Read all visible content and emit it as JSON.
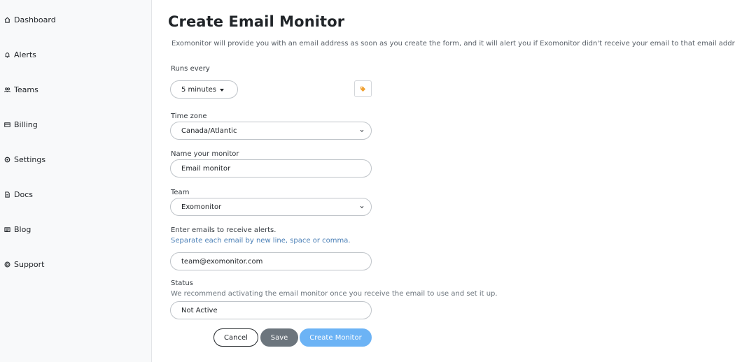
{
  "sidebar": {
    "items": [
      {
        "label": "Dashboard",
        "icon": "home-icon"
      },
      {
        "label": "Alerts",
        "icon": "bell-icon"
      },
      {
        "label": "Teams",
        "icon": "users-icon"
      },
      {
        "label": "Billing",
        "icon": "card-icon"
      },
      {
        "label": "Settings",
        "icon": "gear-icon"
      },
      {
        "label": "Docs",
        "icon": "doc-icon"
      },
      {
        "label": "Blog",
        "icon": "newspaper-icon"
      },
      {
        "label": "Support",
        "icon": "lifebuoy-icon"
      }
    ]
  },
  "form": {
    "title": "Create Email Monitor",
    "description": "Exomonitor will provide you with an email address as soon as you create the form, and it will alert you if Exomonitor didn't receive your email to that email address.",
    "runs_every": {
      "label": "Runs every",
      "value": "5 minutes"
    },
    "tag_icon": "tag-icon",
    "timezone": {
      "label": "Time zone",
      "value": "Canada/Atlantic"
    },
    "name": {
      "label": "Name your monitor",
      "value": "Email monitor"
    },
    "team": {
      "label": "Team",
      "value": "Exomonitor"
    },
    "emails": {
      "label": "Enter emails to receive alerts.",
      "help": "Separate each email by new line, space or comma.",
      "value": "team@exomonitor.com"
    },
    "status": {
      "label": "Status",
      "help": "We recommend activating the email monitor once you receive the email to use and set it up.",
      "value": "Not Active"
    }
  },
  "actions": {
    "cancel": "Cancel",
    "save": "Save",
    "create": "Create Monitor"
  },
  "colors": {
    "primary": "#6cb3f5",
    "secondary": "#6c757d",
    "tag_icon": "#f0a030"
  }
}
